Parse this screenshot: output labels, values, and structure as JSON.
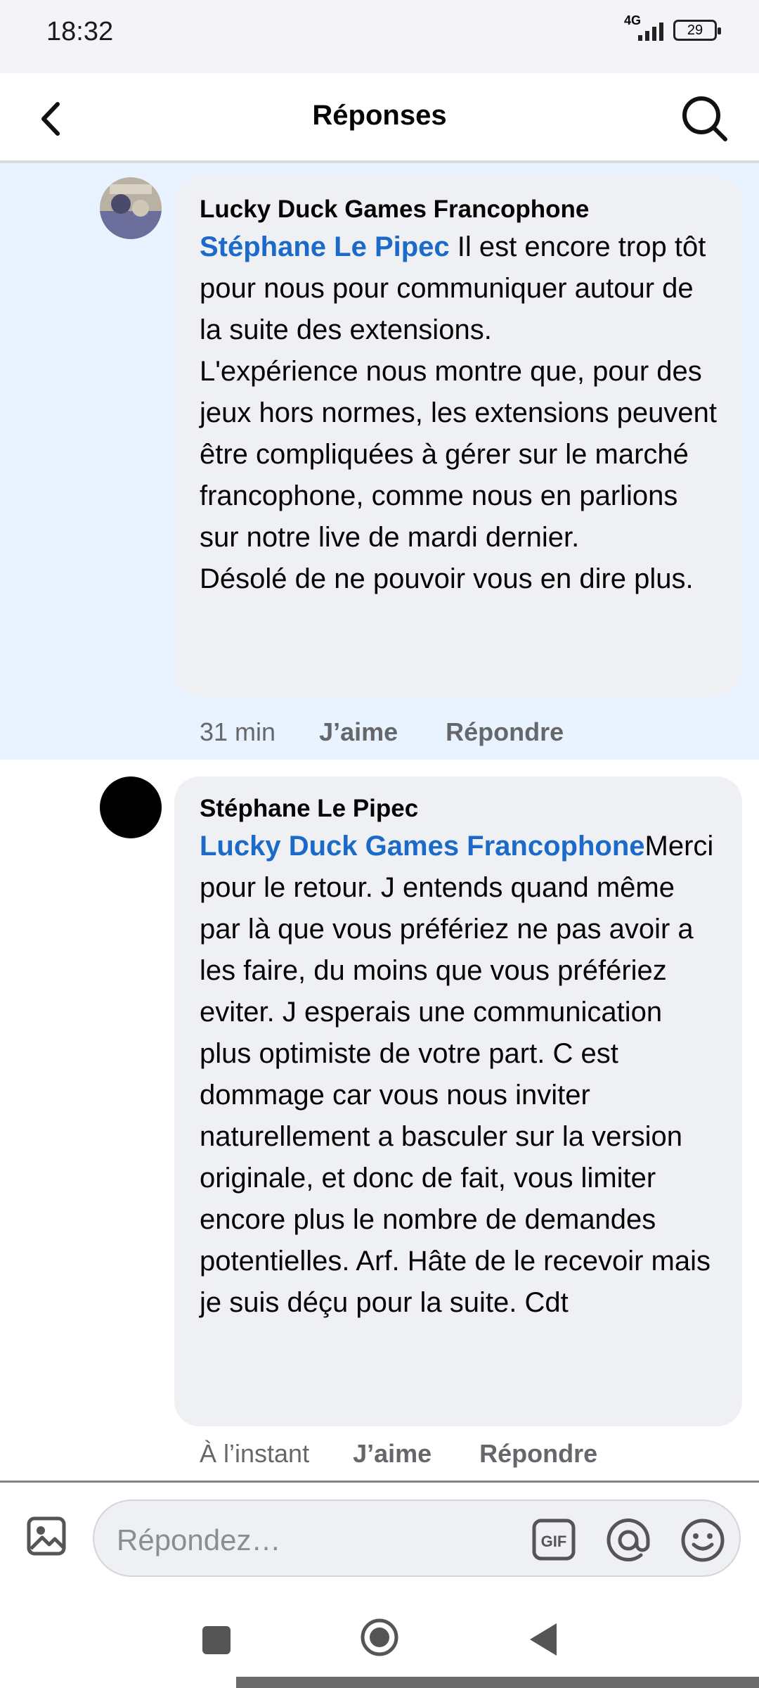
{
  "status_bar": {
    "time": "18:32",
    "network": "4G",
    "battery": "29"
  },
  "header": {
    "title": "Réponses"
  },
  "comments": [
    {
      "author": "Lucky Duck Games Francophone",
      "mention": "Stéphane Le Pipec",
      "text": " Il est encore trop tôt pour nous pour communiquer autour de la suite des extensions.",
      "text2": "L'expérience nous montre que, pour des jeux hors normes, les extensions peuvent être compliquées à gérer sur le marché francophone, comme nous en parlions sur notre live de mardi dernier.",
      "text3": "Désolé de ne pouvoir vous en dire plus.",
      "time": "31 min",
      "like": "J’aime",
      "reply": "Répondre"
    },
    {
      "author": "Stéphane Le Pipec",
      "mention": "Lucky Duck Games Francophone",
      "text": "Merci pour le retour. J entends quand même par là que vous préfériez ne pas avoir a les faire, du moins que vous préfériez eviter. J esperais une communication plus optimiste de votre part. C est dommage car vous nous inviter naturellement a basculer sur la version originale, et donc de fait, vous limiter encore plus le nombre de demandes potentielles. Arf. Hâte de le recevoir mais je suis déçu pour la suite. Cdt",
      "time": "À l’instant",
      "like": "J’aime",
      "reply": "Répondre"
    }
  ],
  "composer": {
    "placeholder": "Répondez…",
    "gif_label": "GIF"
  },
  "icons": [
    "back-arrow-icon",
    "search-icon",
    "photo-icon",
    "gif-icon",
    "at-icon",
    "emoji-icon",
    "nav-recents-icon",
    "nav-home-icon",
    "nav-back-icon"
  ],
  "colors": {
    "highlight": "#e8f3ff",
    "bubble": "#eff0f3",
    "mention": "#1b6ac9"
  }
}
